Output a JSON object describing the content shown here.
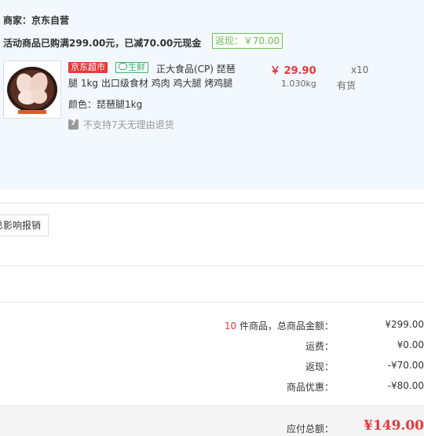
{
  "merchant": {
    "label": "商家：京东自营"
  },
  "promo": {
    "text": "活动商品已购满299.00元，已减70.00元现金",
    "rebate_badge": "返现：￥70.00"
  },
  "product": {
    "badge_jd": "京东超市",
    "badge_fresh_icon": "fresh-icon",
    "badge_fresh": "生鲜",
    "title_line1": "正大食品(CP) 琵琶",
    "title_line2": "腿 1kg 出口级食材 鸡肉 鸡大腿 烤鸡腿",
    "price": "￥ 29.90",
    "weight": "1.030kg",
    "quantity": "x10",
    "stock": "有货",
    "color": "颜色：琵琶腿1kg",
    "no_return": "不支持7天无理由退货"
  },
  "invoice_button": {
    "label": "总影响报销"
  },
  "summary": {
    "count": "10",
    "goods_label": "件商品，总商品金额：",
    "goods_value": "¥299.00",
    "shipping_label": "运费：",
    "shipping_value": "¥0.00",
    "rebate_label": "返现：",
    "rebate_value": "-¥70.00",
    "discount_label": "商品优惠：",
    "discount_value": "-¥80.00"
  },
  "total": {
    "label": "应付总额：",
    "value": "¥149.00"
  },
  "colors": {
    "accent_red": "#e4393c",
    "rebate_green": "#6cbb54",
    "panel_bg": "#f2f8fd"
  }
}
